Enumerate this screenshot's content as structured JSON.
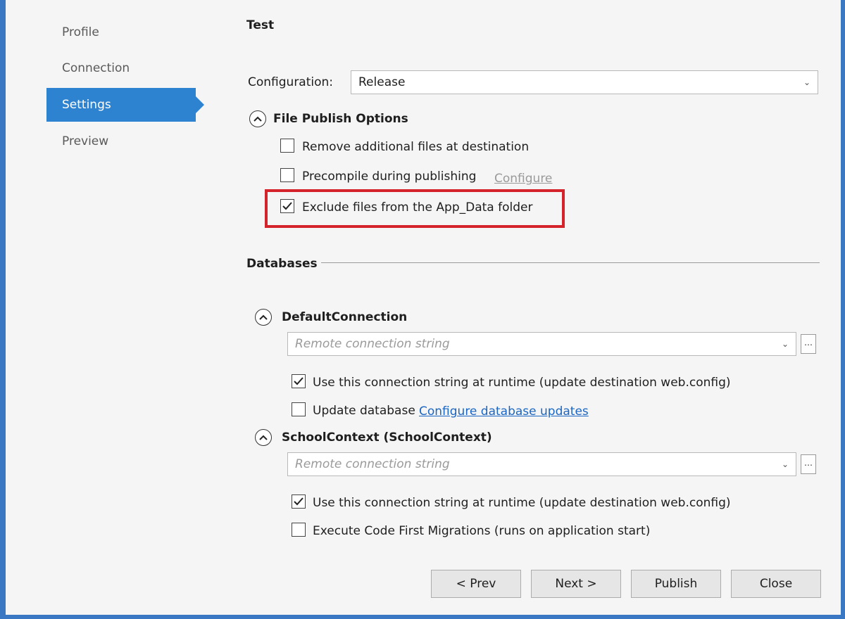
{
  "sidebar": {
    "items": [
      {
        "label": "Profile"
      },
      {
        "label": "Connection"
      },
      {
        "label": "Settings"
      },
      {
        "label": "Preview"
      }
    ]
  },
  "main": {
    "title": "Test",
    "configuration_label": "Configuration:",
    "configuration_value": "Release",
    "file_publish": {
      "header": "File Publish Options",
      "remove_files_label": "Remove additional files at destination",
      "remove_files_checked": false,
      "precompile_label": "Precompile during publishing",
      "precompile_checked": false,
      "configure_link": "Configure",
      "exclude_label": "Exclude files from the App_Data folder",
      "exclude_checked": true
    },
    "databases": {
      "header": "Databases",
      "default_connection": {
        "title": "DefaultConnection",
        "placeholder": "Remote connection string",
        "use_runtime_label": "Use this connection string at runtime (update destination web.config)",
        "use_runtime_checked": true,
        "update_db_label": "Update database",
        "update_db_checked": false,
        "configure_updates_link": "Configure database updates"
      },
      "school_context": {
        "title": "SchoolContext (SchoolContext)",
        "placeholder": "Remote connection string",
        "use_runtime_label": "Use this connection string at runtime (update destination web.config)",
        "use_runtime_checked": true,
        "migrations_label": "Execute Code First Migrations (runs on application start)",
        "migrations_checked": false
      }
    }
  },
  "buttons": {
    "prev": "< Prev",
    "next": "Next >",
    "publish": "Publish",
    "close": "Close"
  },
  "colors": {
    "accent": "#2e83d0",
    "frame": "#3b78c4",
    "highlight": "#d4232a",
    "link": "#1a66c2"
  },
  "icons": {
    "chevron": "chevron-down-icon",
    "collapse": "chevron-up-circle-icon",
    "checkmark": "checkmark-icon"
  }
}
